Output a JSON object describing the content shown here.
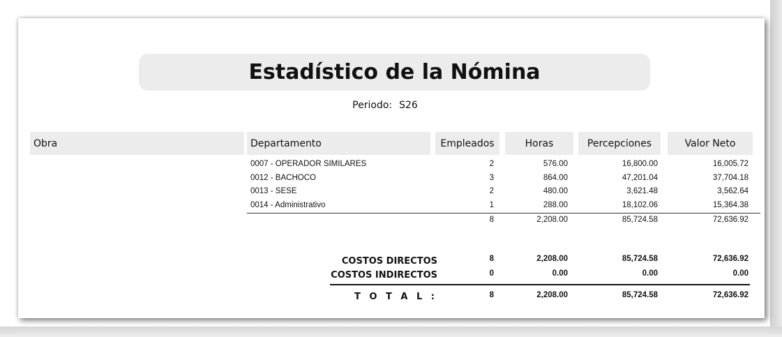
{
  "report": {
    "title": "Estadístico de la Nómina",
    "period_label": "Periodo:",
    "period_value": "S26"
  },
  "table": {
    "headers": {
      "obra": "Obra",
      "departamento": "Departamento",
      "empleados": "Empleados",
      "horas": "Horas",
      "percepciones": "Percepciones",
      "valor_neto": "Valor Neto"
    },
    "rows": [
      {
        "departamento": "0007 - OPERADOR SIMILARES",
        "empleados": "2",
        "horas": "576.00",
        "percepciones": "16,800.00",
        "valor_neto": "16,005.72"
      },
      {
        "departamento": "0012 - BACHOCO",
        "empleados": "3",
        "horas": "864.00",
        "percepciones": "47,201.04",
        "valor_neto": "37,704.18"
      },
      {
        "departamento": "0013 - SESE",
        "empleados": "2",
        "horas": "480.00",
        "percepciones": "3,621.48",
        "valor_neto": "3,562.64"
      },
      {
        "departamento": "0014 - Administrativo",
        "empleados": "1",
        "horas": "288.00",
        "percepciones": "18,102.06",
        "valor_neto": "15,364.38"
      }
    ],
    "subtotal": {
      "empleados": "8",
      "horas": "2,208.00",
      "percepciones": "85,724.58",
      "valor_neto": "72,636.92"
    }
  },
  "summary": {
    "costos_directos": {
      "label": "COSTOS DIRECTOS",
      "empleados": "8",
      "horas": "2,208.00",
      "percepciones": "85,724.58",
      "valor_neto": "72,636.92"
    },
    "costos_indirectos": {
      "label": "COSTOS INDIRECTOS",
      "empleados": "0",
      "horas": "0.00",
      "percepciones": "0.00",
      "valor_neto": "0.00"
    },
    "total": {
      "label": "T O T A L :",
      "empleados": "8",
      "horas": "2,208.00",
      "percepciones": "85,724.58",
      "valor_neto": "72,636.92"
    }
  }
}
